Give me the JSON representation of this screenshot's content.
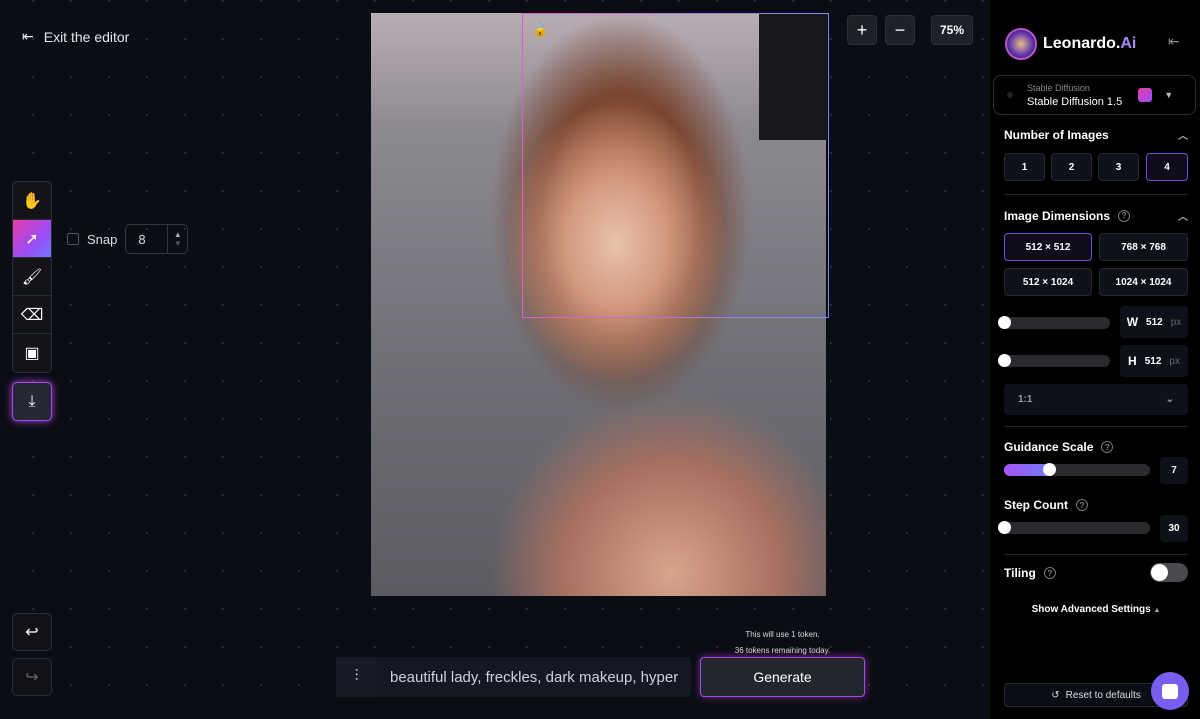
{
  "editor": {
    "exit_label": "Exit the editor",
    "snap_label": "Snap",
    "snap_value": "8",
    "zoom_level": "75%",
    "prompt_value": "beautiful lady, freckles, dark makeup, hyper",
    "token_use": "This will use 1 token.",
    "tokens_remaining": "36 tokens remaining today.",
    "generate_label": "Generate",
    "tools": [
      "hand-icon",
      "select-icon",
      "brush-icon",
      "eraser-icon",
      "image-icon"
    ],
    "active_tool": "select-icon"
  },
  "sidebar": {
    "brand": "Leonardo.",
    "brand_accent": "Ai",
    "model_caption": "Stable Diffusion",
    "model_name": "Stable Diffusion 1.5",
    "num_images": {
      "title": "Number of Images",
      "options": [
        "1",
        "2",
        "3",
        "4"
      ],
      "selected": "4"
    },
    "dimensions": {
      "title": "Image Dimensions",
      "options": [
        "512 × 512",
        "768 × 768",
        "512 × 1024",
        "1024 × 1024"
      ],
      "selected": "512 × 512",
      "w_label": "W",
      "w_value": "512",
      "h_label": "H",
      "h_value": "512",
      "unit": "px",
      "aspect": "1:1"
    },
    "guidance": {
      "title": "Guidance Scale",
      "value": "7"
    },
    "steps": {
      "title": "Step Count",
      "value": "30"
    },
    "tiling": {
      "title": "Tiling",
      "on": false
    },
    "advanced_label": "Show Advanced Settings",
    "reset_label": "Reset to defaults"
  },
  "colors": {
    "accent": "#9b4cf7",
    "pink": "#e63ea8",
    "chat": "#7b5cf0"
  }
}
